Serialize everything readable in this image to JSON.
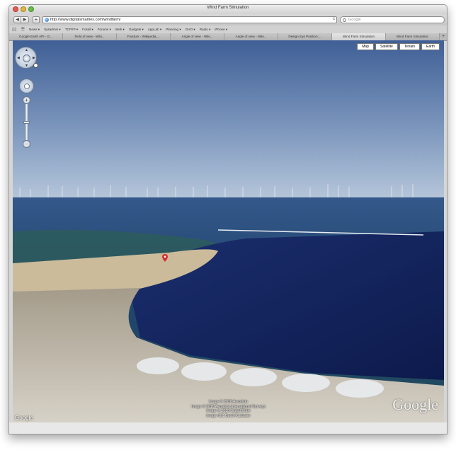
{
  "window": {
    "title": "Wind Farm Simulation"
  },
  "toolbar": {
    "back_glyph": "◀",
    "forward_glyph": "▶",
    "add_glyph": "+",
    "url": "http://www.digitalsmarties.com/windfarm/",
    "reload_glyph": "c",
    "search_placeholder": "Google"
  },
  "bookmarks": {
    "icons": [
      "▯▯",
      "☰"
    ],
    "items": [
      "News ▾",
      "Sysadmin ▾",
      "TCP/IP ▾",
      "Fossil ▾",
      "Forums ▾",
      "Web ▾",
      "Gadgets ▾",
      "AppLab ▾",
      "Planning ▾",
      "GHO ▾",
      "Radio ▾",
      "iPhone ▾"
    ]
  },
  "tabs": {
    "items": [
      "Google Earth API - G...",
      "Field of view - Wiki...",
      "Frustum - Wikipedia,...",
      "Angle of view - Wiki...",
      "Angle of view - Wiki...",
      "Design Eye Position:...",
      "Wind Farm Simulation",
      "Wind Farm Simulation"
    ],
    "active_index": 6,
    "add_glyph": "+"
  },
  "map": {
    "map_types": [
      "Map",
      "Satellite",
      "Terrain",
      "Earth"
    ],
    "zoom_in_glyph": "+",
    "zoom_out_glyph": "−",
    "attribution": [
      "Image © 2010 Aerodata",
      "Image © 2010 Aerodata International Surveys",
      "Image © 2010 DigitalGlobe",
      "Image IGC Dutch Kadaster"
    ],
    "logo_big": "Google",
    "logo_small": "Google",
    "colors": {
      "sky_top": "#3f5f96",
      "sky_horizon": "#b9c9dc",
      "sea": "#1a2f6a",
      "lagoon": "#0f1d52",
      "beach": "#c9b99a",
      "pin": "#d42a2a"
    }
  }
}
